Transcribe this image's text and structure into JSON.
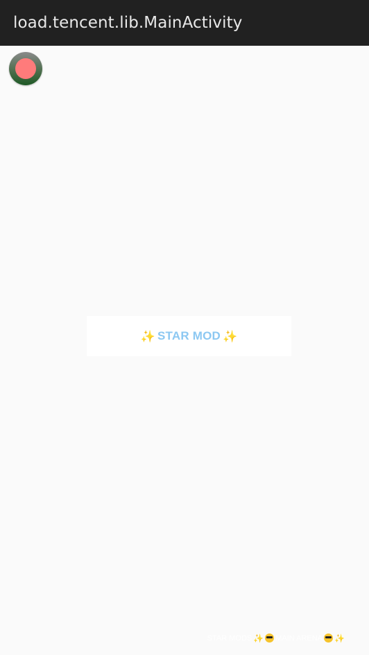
{
  "app_bar": {
    "title": "load.tencent.lib.MainActivity"
  },
  "floating_button": {
    "icon": "record-dot-icon",
    "inner_color": "#ff7b7b"
  },
  "center_card": {
    "label": "STAR MOD",
    "sparkle": "✨",
    "label_color": "#8cc8f2"
  },
  "footer": {
    "part1": "STAR MODS",
    "part2": "MAIN ARENA",
    "sparkle": "✨"
  }
}
